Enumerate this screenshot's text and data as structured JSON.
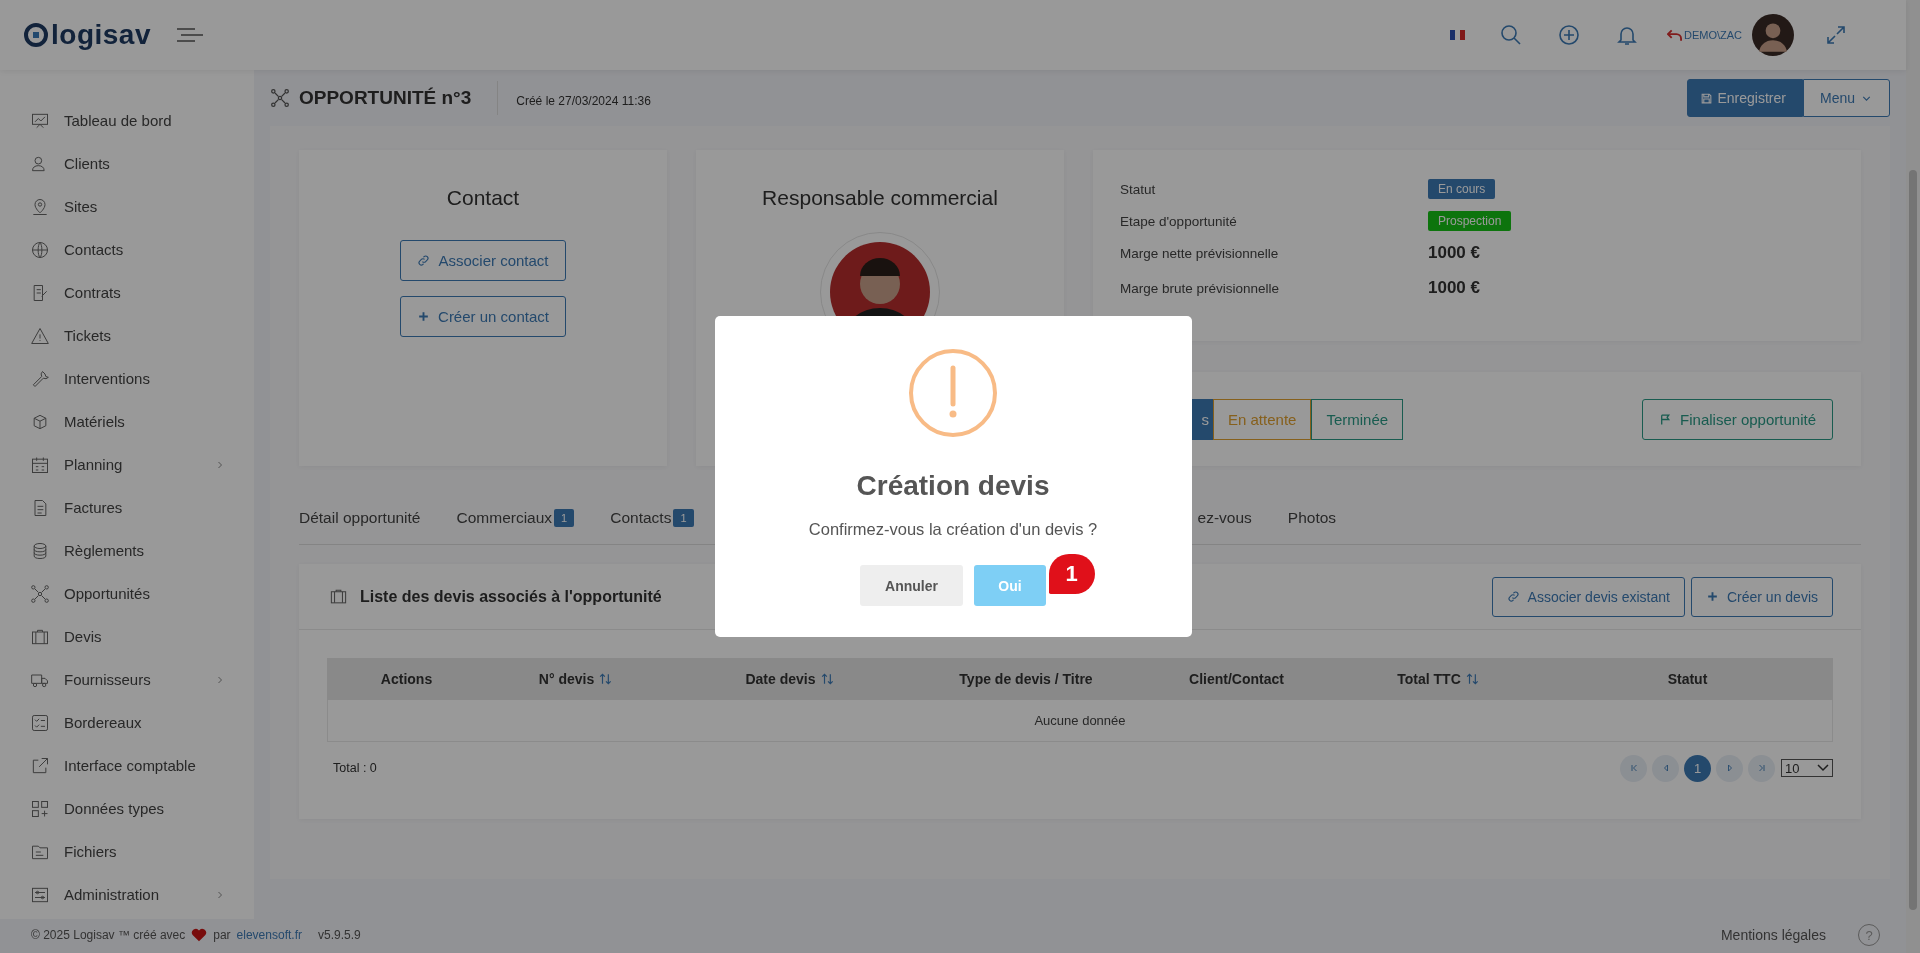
{
  "header": {
    "logo": "logisav",
    "user": "DEMO\\ZAC"
  },
  "sidebar": {
    "items": [
      {
        "label": "Tableau de bord",
        "has_submenu": false
      },
      {
        "label": "Clients",
        "has_submenu": false
      },
      {
        "label": "Sites",
        "has_submenu": false
      },
      {
        "label": "Contacts",
        "has_submenu": false
      },
      {
        "label": "Contrats",
        "has_submenu": false
      },
      {
        "label": "Tickets",
        "has_submenu": false
      },
      {
        "label": "Interventions",
        "has_submenu": false
      },
      {
        "label": "Matériels",
        "has_submenu": false
      },
      {
        "label": "Planning",
        "has_submenu": true
      },
      {
        "label": "Factures",
        "has_submenu": false
      },
      {
        "label": "Règlements",
        "has_submenu": false
      },
      {
        "label": "Opportunités",
        "has_submenu": false
      },
      {
        "label": "Devis",
        "has_submenu": false
      },
      {
        "label": "Fournisseurs",
        "has_submenu": true
      },
      {
        "label": "Bordereaux",
        "has_submenu": false
      },
      {
        "label": "Interface comptable",
        "has_submenu": false
      },
      {
        "label": "Données types",
        "has_submenu": false
      },
      {
        "label": "Fichiers",
        "has_submenu": false
      },
      {
        "label": "Administration",
        "has_submenu": true
      }
    ]
  },
  "page": {
    "title": "OPPORTUNITÉ n°3",
    "created": "Créé le 27/03/2024 11:36",
    "buttons": [
      {
        "label": "Enregistrer",
        "kind": "primary"
      },
      {
        "label": "Menu",
        "kind": "dropdown"
      }
    ]
  },
  "contact_card": {
    "title": "Contact",
    "buttons": [
      {
        "label": "Associer contact",
        "kind": "link"
      },
      {
        "label": "Créer un contact",
        "kind": "add"
      }
    ]
  },
  "sales_card": {
    "title": "Responsable commercial"
  },
  "details": [
    {
      "label": "Statut",
      "value": "En cours",
      "kind": "info"
    },
    {
      "label": "Etape d'opportunité",
      "value": "Prospection",
      "kind": "success"
    },
    {
      "label": "Marge nette prévisionnelle",
      "value": "1000 €",
      "kind": "amount"
    },
    {
      "label": "Marge brute prévisionnelle",
      "value": "1000 €",
      "kind": "amount"
    }
  ],
  "steps": [
    {
      "label": "s",
      "selected": true,
      "kind": "current"
    },
    {
      "label": "En attente",
      "selected": false,
      "kind": "pending"
    },
    {
      "label": "Terminée",
      "selected": false,
      "kind": "done"
    }
  ],
  "finalize_button": "Finaliser opportunité",
  "tabs": [
    {
      "label": "Détail opportunité"
    },
    {
      "label": "Commerciaux",
      "count": "1"
    },
    {
      "label": "Contacts",
      "count": "1"
    },
    {
      "label": "ez-vous"
    },
    {
      "label": "Photos"
    }
  ],
  "quotes": {
    "title": "Liste des devis associés à l'opportunité",
    "buttons": [
      {
        "label": "Associer devis existant",
        "kind": "link"
      },
      {
        "label": "Créer un devis",
        "kind": "add"
      }
    ],
    "columns": [
      {
        "label": "Actions",
        "sortable": false
      },
      {
        "label": "N° devis",
        "sortable": true
      },
      {
        "label": "Date devis",
        "sortable": true
      },
      {
        "label": "Type de devis / Titre",
        "sortable": false
      },
      {
        "label": "Client/Contact",
        "sortable": false
      },
      {
        "label": "Total TTC",
        "sortable": true
      },
      {
        "label": "Statut",
        "sortable": false
      }
    ],
    "empty": "Aucune donnée",
    "total": "Total : 0",
    "page": "1",
    "page_size": "10"
  },
  "footer": {
    "copyright": "© 2025 Logisav ™ créé avec",
    "by": "par",
    "link": "elevensoft.fr",
    "version": "v5.9.5.9",
    "legal": "Mentions légales",
    "help": "?"
  },
  "dialog": {
    "title": "Création devis",
    "message": "Confirmez-vous la création d'un devis ?",
    "buttons": [
      {
        "label": "Annuler",
        "kind": "cancel"
      },
      {
        "label": "Oui",
        "kind": "confirm"
      }
    ]
  },
  "callout": {
    "label": "1"
  }
}
